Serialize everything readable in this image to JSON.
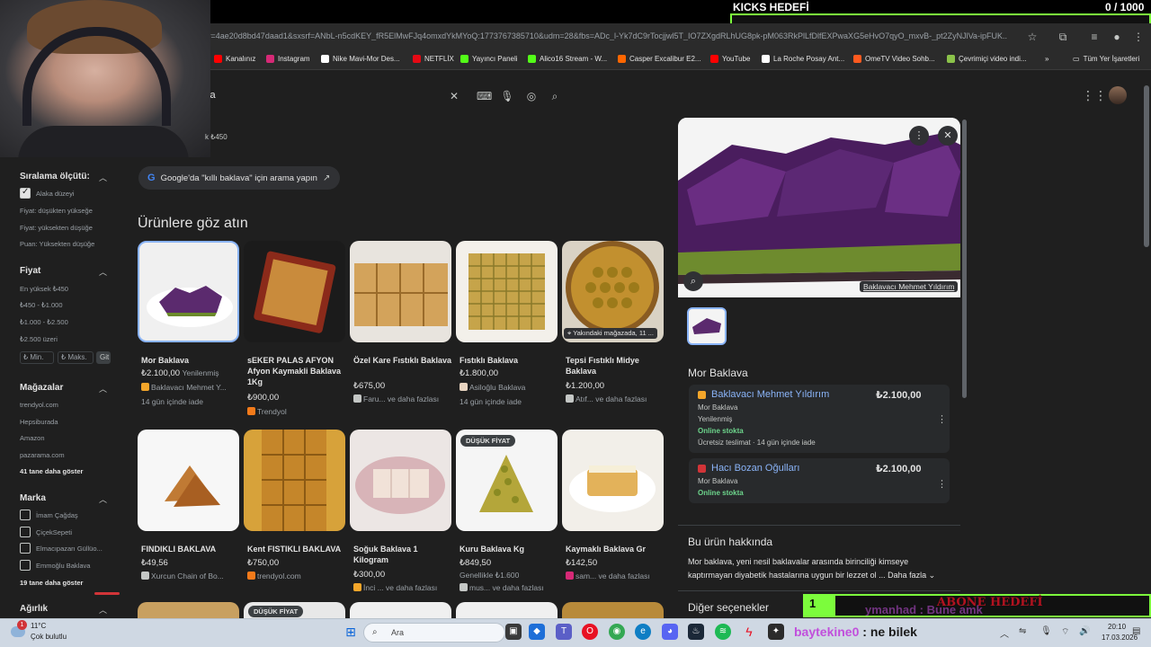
{
  "overlay": {
    "kicks_title": "KICKS HEDEFİ",
    "kicks_count": "0 / 1000",
    "abone_num": "1",
    "abone_label": "ABONE HEDEFİ",
    "chat_ghost": "ymanhad : Bune amk",
    "chat_user": "baytekine0",
    "chat_msg": " : ne bilek",
    "accent": "#7cfc3c"
  },
  "browser": {
    "url": "v=4ae20d8bd47daad1&sxsrf=ANbL-n5cdKEY_fR5ElMwFJq4omxdYkMYoQ:1773767385710&udm=28&fbs=ADc_l-Yk7dC9rTocjjwl5T_IO7ZXgdRLhUG8pk-pM063RkPlLfDlfEXPwaXG5eHvO7qyO_mxvB-_pt2ZyNJlVa-ipFUK...",
    "bookmarks": [
      "Kanalınız",
      "Instagram",
      "Nike Mavi-Mor Des...",
      "NETFLİX",
      "Yayıncı Paneli",
      "Alico16 Stream - W...",
      "Casper Excalibur E2...",
      "YouTube",
      "La Roche Posay Ant...",
      "OmeTV Video Sohb...",
      "Çevrimiçi video indi..."
    ],
    "bookmark_colors": [
      "#ff0000",
      "#d62976",
      "#ffffff",
      "#e50914",
      "#53fc18",
      "#53fc18",
      "#ff6600",
      "#ff0000",
      "#ffffff",
      "#ff5a1f",
      "#8bc34a"
    ],
    "all_bookmarks": "Tüm Yer İşaretleri",
    "search_query": "va",
    "chip_fragment": "k ₺450"
  },
  "filters": {
    "sort_title": "Sıralama ölçütü:",
    "sort_items": [
      "Alaka düzeyi",
      "Fiyat: düşükten yükseğe",
      "Fiyat: yüksekten düşüğe",
      "Puan: Yüksekten düşüğe"
    ],
    "price_title": "Fiyat",
    "price_items": [
      "En yüksek ₺450",
      "₺450 - ₺1.000",
      "₺1.000 - ₺2.500",
      "₺2.500 üzeri"
    ],
    "min": "₺ Min.",
    "max": "₺ Maks.",
    "go": "Git",
    "stores_title": "Mağazalar",
    "stores": [
      "trendyol.com",
      "Hepsiburada",
      "Amazon",
      "pazarama.com"
    ],
    "stores_more": "41 tane daha göster",
    "brand_title": "Marka",
    "brands": [
      "İmam Çağdaş",
      "ÇiçekSepeti",
      "Elmacıpazarı Güllüo...",
      "Emmoğlu Baklava"
    ],
    "brands_more": "19 tane daha göster",
    "weight_title": "Ağırlık"
  },
  "main": {
    "google_chip": "Google'da \"kıllı baklava\" için arama yapın",
    "section_title": "Ürünlere göz atın",
    "row1": [
      {
        "title": "Mor Baklava",
        "price": "₺2.100,00",
        "extra": "Yenilenmiş",
        "seller": "Baklavacı Mehmet Y...",
        "ship": "14 gün içinde iade"
      },
      {
        "title": "sEKER PALAS AFYON Afyon Kaymakli Baklava 1Kg",
        "price": "₺900,00",
        "extra": "",
        "seller": "Trendyol",
        "ship": ""
      },
      {
        "title": "Özel Kare Fıstıklı Baklava",
        "price": "₺675,00",
        "extra": "",
        "seller": "Faru... ve daha fazlası",
        "ship": ""
      },
      {
        "title": "Fıstıklı Baklava",
        "price": "₺1.800,00",
        "extra": "",
        "seller": "Asiloğlu Baklava",
        "ship": "14 gün içinde iade"
      },
      {
        "title": "Tepsi Fıstıklı Midye Baklava",
        "price": "₺1.200,00",
        "extra": "",
        "seller": "Atıf... ve daha fazlası",
        "ship": ""
      }
    ],
    "nearby_label": "Yakındaki mağazada, 11 ...",
    "row2": [
      {
        "title": "FINDIKLI BAKLAVA",
        "price": "₺49,56",
        "seller": "Xurcun Chain of Bo...",
        "extra": ""
      },
      {
        "title": "Kent FISTIKLI BAKLAVA",
        "price": "₺750,00",
        "seller": "trendyol.com",
        "extra": ""
      },
      {
        "title": "Soğuk Baklava 1 Kilogram",
        "price": "₺300,00",
        "seller": "İnci ... ve daha fazlası",
        "extra": ""
      },
      {
        "title": "Kuru Baklava Kg",
        "price": "₺849,50",
        "seller": "mus... ve daha fazlası",
        "extra": "Genellikle ₺1.600"
      },
      {
        "title": "Kaymaklı Baklava Gr",
        "price": "₺142,50",
        "seller": "sam... ve daha fazlası",
        "extra": ""
      }
    ],
    "badge_low": "DÜŞÜK FİYAT"
  },
  "panel": {
    "credit": "Baklavacı Mehmet Yıldırım",
    "product_name": "Mor Baklava",
    "offers": [
      {
        "seller": "Baklavacı Mehmet Yıldırım",
        "price": "₺2.100,00",
        "name": "Mor Baklava",
        "cond": "Yenilenmiş",
        "stock": "Online stokta",
        "ship": "Ücretsiz teslimat · 14 gün içinde iade"
      },
      {
        "seller": "Hacı Bozan Oğulları",
        "price": "₺2.100,00",
        "name": "Mor Baklava",
        "cond": "",
        "stock": "Online stokta",
        "ship": ""
      }
    ],
    "about_title": "Bu ürün hakkında",
    "about_text": "Mor baklava, yeni nesil baklavalar arasında birinciliği kimseye kaptırmayan diyabetik hastalarına uygun bir lezzet ol ...",
    "more": "Daha fazla",
    "other_title": "Diğer seçenekler"
  },
  "taskbar": {
    "weather_badge": "1",
    "temp": "11°C",
    "weather": "Çok bulutlu",
    "search": "Ara",
    "time": "20:10",
    "date": "17.03.2026"
  }
}
